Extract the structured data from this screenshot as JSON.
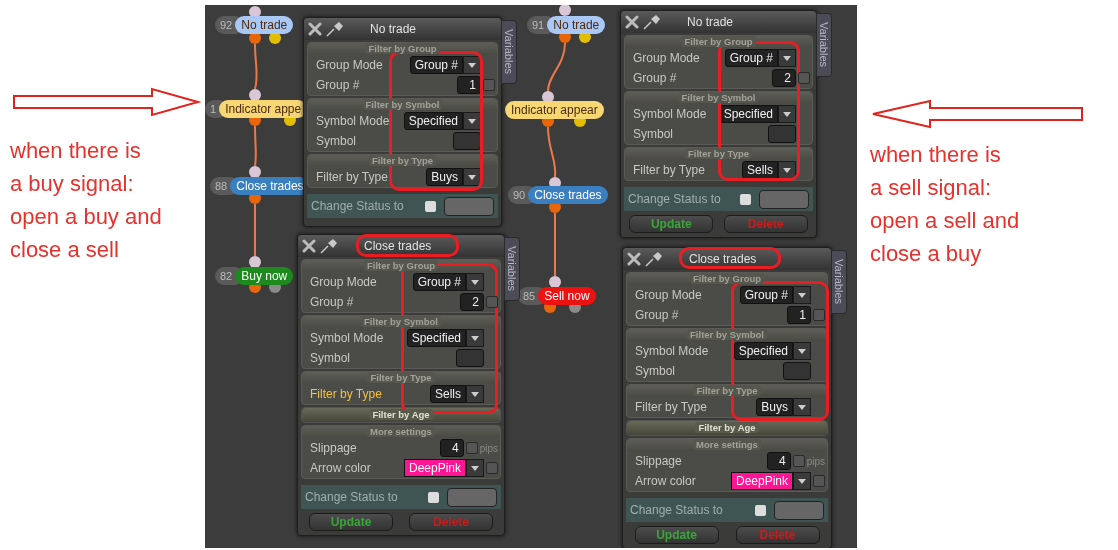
{
  "note_left": {
    "points_right": true,
    "lines": [
      "when there is",
      "a buy signal:",
      "open a buy and",
      "close a sell"
    ]
  },
  "flow_columns": [
    [
      {
        "number": "92",
        "label": "No trade",
        "color": "#a9c8f5"
      },
      {
        "number": "1",
        "label": "Indicator appe",
        "color": "#f7d774"
      },
      {
        "number": "88",
        "label": "Close trades",
        "color": "#3a7fc0"
      },
      {
        "number": "82",
        "label": "Buy now",
        "color": "#1d8a1d"
      }
    ],
    [
      {
        "number": "91",
        "label": "No trade",
        "color": "#a9c8f5"
      },
      {
        "label": "Indicator appear",
        "color": "#f7d774"
      },
      {
        "number": "90",
        "label": "Close trades",
        "color": "#3a7fc0"
      },
      {
        "number": "85",
        "label": "Sell now",
        "color": "#ee1111"
      }
    ]
  ],
  "dialogs": [
    {
      "title": "No trade",
      "tab": "Variables",
      "title_circled": false,
      "values_circled": true,
      "sections": [
        {
          "title": "Filter by Group",
          "expanded": true,
          "rows": [
            {
              "kind": "dropdown",
              "label": "Group Mode",
              "value": "Group #",
              "highlighted": false
            },
            {
              "kind": "number",
              "label": "Group #",
              "value": "1",
              "checked": false,
              "highlighted": false
            }
          ]
        },
        {
          "title": "Filter by Symbol",
          "expanded": true,
          "rows": [
            {
              "kind": "dropdown",
              "label": "Symbol Mode",
              "value": "Specified",
              "highlighted": false
            },
            {
              "kind": "field",
              "label": "Symbol",
              "highlighted": false
            }
          ]
        },
        {
          "title": "Filter by Type",
          "expanded": true,
          "rows": [
            {
              "kind": "dropdown",
              "label": "Filter by Type",
              "value": "Buys",
              "highlighted": false
            }
          ]
        }
      ],
      "status": {
        "label": "Change Status to",
        "checked": false
      }
    },
    {
      "title": "Close trades",
      "tab": "Variables",
      "title_circled": true,
      "values_circled": true,
      "sections": [
        {
          "title": "Filter by Group",
          "expanded": true,
          "rows": [
            {
              "kind": "dropdown",
              "label": "Group Mode",
              "value": "Group #",
              "highlighted": false
            },
            {
              "kind": "number",
              "label": "Group #",
              "value": "2",
              "checked": false,
              "highlighted": false
            }
          ]
        },
        {
          "title": "Filter by Symbol",
          "expanded": true,
          "rows": [
            {
              "kind": "dropdown",
              "label": "Symbol Mode",
              "value": "Specified",
              "highlighted": false
            },
            {
              "kind": "field",
              "label": "Symbol",
              "highlighted": false
            }
          ]
        },
        {
          "title": "Filter by Type",
          "expanded": true,
          "rows": [
            {
              "kind": "dropdown",
              "label": "Filter by Type",
              "value": "Sells",
              "highlighted": true
            }
          ]
        },
        {
          "title": "Filter by Age",
          "expanded": false
        },
        {
          "title": "More settings",
          "expanded": true,
          "rows": [
            {
              "kind": "number",
              "label": "Slippage",
              "value": "4",
              "checked": false,
              "unit": "pips",
              "highlighted": false
            },
            {
              "kind": "color",
              "label": "Arrow color",
              "value": "DeepPink",
              "color": "#ff1493",
              "checked": false,
              "highlighted": false
            }
          ]
        }
      ],
      "status": {
        "label": "Change Status to",
        "checked": false
      },
      "buttons": [
        {
          "kind": "update",
          "label": "Update"
        },
        {
          "kind": "delete",
          "label": "Delete"
        }
      ]
    },
    {
      "title": "No trade",
      "tab": "Variables",
      "title_circled": false,
      "values_circled": true,
      "sections": [
        {
          "title": "Filter by Group",
          "expanded": true,
          "rows": [
            {
              "kind": "dropdown",
              "label": "Group Mode",
              "value": "Group #",
              "highlighted": false
            },
            {
              "kind": "number",
              "label": "Group #",
              "value": "2",
              "checked": false,
              "highlighted": false
            }
          ]
        },
        {
          "title": "Filter by Symbol",
          "expanded": true,
          "rows": [
            {
              "kind": "dropdown",
              "label": "Symbol Mode",
              "value": "Specified",
              "highlighted": false
            },
            {
              "kind": "field",
              "label": "Symbol",
              "highlighted": false
            }
          ]
        },
        {
          "title": "Filter by Type",
          "expanded": true,
          "rows": [
            {
              "kind": "dropdown",
              "label": "Filter by Type",
              "value": "Sells",
              "highlighted": false
            }
          ]
        }
      ],
      "status": {
        "label": "Change Status to",
        "checked": false
      },
      "buttons": [
        {
          "kind": "update",
          "label": "Update"
        },
        {
          "kind": "delete",
          "label": "Delete"
        }
      ]
    },
    {
      "title": "Close trades",
      "tab": "Variables",
      "title_circled": true,
      "values_circled": true,
      "sections": [
        {
          "title": "Filter by Group",
          "expanded": true,
          "rows": [
            {
              "kind": "dropdown",
              "label": "Group Mode",
              "value": "Group #",
              "highlighted": false
            },
            {
              "kind": "number",
              "label": "Group #",
              "value": "1",
              "checked": false,
              "highlighted": false
            }
          ]
        },
        {
          "title": "Filter by Symbol",
          "expanded": true,
          "rows": [
            {
              "kind": "dropdown",
              "label": "Symbol Mode",
              "value": "Specified",
              "highlighted": false
            },
            {
              "kind": "field",
              "label": "Symbol",
              "highlighted": false
            }
          ]
        },
        {
          "title": "Filter by Type",
          "expanded": true,
          "rows": [
            {
              "kind": "dropdown",
              "label": "Filter by Type",
              "value": "Buys",
              "highlighted": false
            }
          ]
        },
        {
          "title": "Filter by Age",
          "expanded": false
        },
        {
          "title": "More settings",
          "expanded": true,
          "rows": [
            {
              "kind": "number",
              "label": "Slippage",
              "value": "4",
              "checked": false,
              "unit": "pips",
              "highlighted": false
            },
            {
              "kind": "color",
              "label": "Arrow color",
              "value": "DeepPink",
              "color": "#ff1493",
              "checked": false,
              "highlighted": false
            }
          ]
        }
      ],
      "status": {
        "label": "Change Status to",
        "checked": false
      },
      "buttons": [
        {
          "kind": "update",
          "label": "Update"
        },
        {
          "kind": "delete",
          "label": "Delete"
        }
      ]
    }
  ],
  "note_right": {
    "points_right": false,
    "lines": [
      "when there is",
      "a sell signal:",
      "open a sell and",
      "close a buy"
    ]
  }
}
